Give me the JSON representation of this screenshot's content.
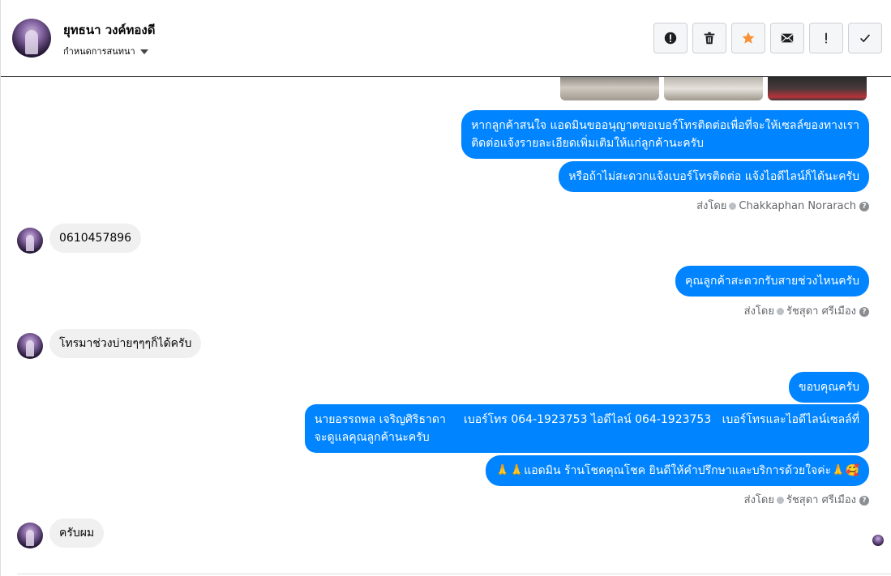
{
  "header": {
    "contact_name": "ยุทธนา วงค์ทองดี",
    "assign_label": "กำหนดการสนทนา",
    "toolbar": [
      {
        "name": "spam-report-button",
        "icon": "alert-circle-icon"
      },
      {
        "name": "delete-button",
        "icon": "trash-icon"
      },
      {
        "name": "star-button",
        "icon": "star-icon"
      },
      {
        "name": "mark-unread-button",
        "icon": "envelope-icon"
      },
      {
        "name": "follow-up-button",
        "icon": "exclamation-icon"
      },
      {
        "name": "mark-done-button",
        "icon": "checkmark-icon"
      }
    ],
    "star_color": "#f7923a"
  },
  "messages": {
    "out1": "หากลูกค้าสนใจ แอดมินขออนุญาตขอเบอร์โทรติดต่อเพื่อที่จะให้เซลล์ของทางเราติดต่อแจ้งรายละเอียดเพิ่มเติมให้แก่ลูกค้านะครับ",
    "out1_line1": "หากลูกค้าสนใจ แอดมินขออนุญาตขอเบอร์โทรติดต่อเพื่อที่จะให้เซลล์ของทางเรา",
    "out1_line2": "ติดต่อแจ้งรายละเอียดเพิ่มเติมให้แก่ลูกค้านะครับ",
    "out2": "หรือถ้าไม่สะดวกแจ้งเบอร์โทรติดต่อ แจ้งไอดีไลน์ก็ได้นะครับ",
    "sent_by_1_prefix": "ส่งโดย",
    "sent_by_1_name": "Chakkaphan Norarach",
    "in1": "0610457896",
    "out3": "คุณลูกค้าสะดวกรับสายช่วงไหนครับ",
    "sent_by_2_prefix": "ส่งโดย",
    "sent_by_2_name": "รัชสุดา ศรีเมือง",
    "in2": "โทรมาช่วงบ่ายๆๆๆก็ได้ครับ",
    "out4": "ขอบคุณครับ",
    "out5_line1": "นายอรรถพล เจริญศิริธาดา     เบอร์โทร 064-1923753 ไอดีไลน์ 064-1923753   เบอร์โทรและไอดีไลน์เซลล์ที่",
    "out5_line2": "จะดูแลคุณลูกค้านะครับ",
    "out6": "🙏🙏แอดมิน ร้านโชคคุณโชค ยินดีให้คำปรึกษาและบริการด้วยใจค่ะ🙏🥰",
    "sent_by_3_prefix": "ส่งโดย",
    "sent_by_3_name": "รัชสุดา ศรีเมือง",
    "in3": "ครับผม"
  },
  "colors": {
    "outgoing_bubble": "#0084ff",
    "incoming_bubble": "#f0f0f0"
  }
}
